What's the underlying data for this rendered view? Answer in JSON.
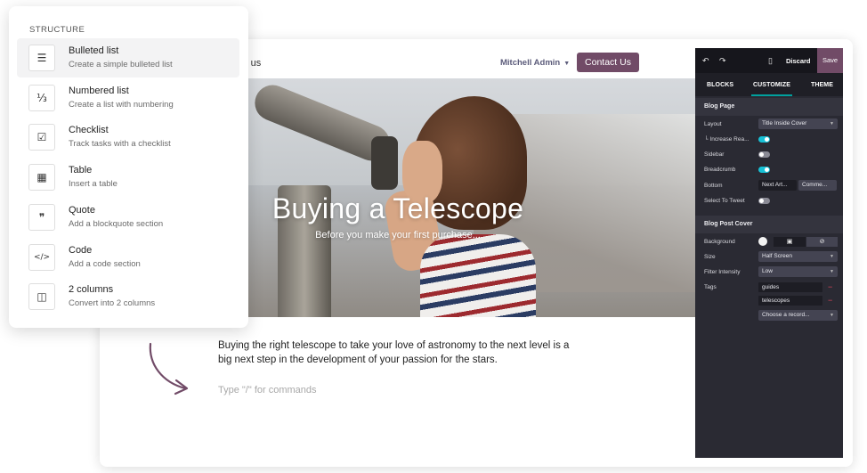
{
  "site": {
    "nav_link": "ct us",
    "user_name": "Mitchell Admin",
    "contact_button": "Contact Us"
  },
  "hero": {
    "title": "Buying a Telescope",
    "subtitle": "Before you make your first purchase..."
  },
  "article": {
    "paragraph": "Buying the right telescope to take your love of astronomy to the next level is a big next step in the development of your passion for the stars.",
    "command_placeholder": "Type \"/\" for commands"
  },
  "command_menu": {
    "header": "STRUCTURE",
    "items": [
      {
        "title": "Bulleted list",
        "desc": "Create a simple bulleted list",
        "icon": "list-ul-icon",
        "glyph": "☰"
      },
      {
        "title": "Numbered list",
        "desc": "Create a list with numbering",
        "icon": "list-ol-icon",
        "glyph": "⅓"
      },
      {
        "title": "Checklist",
        "desc": "Track tasks with a checklist",
        "icon": "check-square-icon",
        "glyph": "☑"
      },
      {
        "title": "Table",
        "desc": "Insert a table",
        "icon": "table-icon",
        "glyph": "▦"
      },
      {
        "title": "Quote",
        "desc": "Add a blockquote section",
        "icon": "quote-icon",
        "glyph": "❞"
      },
      {
        "title": "Code",
        "desc": "Add a code section",
        "icon": "code-icon",
        "glyph": "</>"
      },
      {
        "title": "2 columns",
        "desc": "Convert into 2 columns",
        "icon": "columns-icon",
        "glyph": "◫"
      }
    ]
  },
  "editor": {
    "undo_icon": "undo-icon",
    "redo_icon": "redo-icon",
    "mobile_icon": "mobile-icon",
    "discard": "Discard",
    "save": "Save",
    "tabs": [
      "BLOCKS",
      "CUSTOMIZE",
      "THEME"
    ],
    "blog_page": {
      "title": "Blog Page",
      "layout_label": "Layout",
      "layout_value": "Title Inside Cover",
      "increase_label": "└ Increase Rea...",
      "sidebar_label": "Sidebar",
      "breadcrumb_label": "Breadcrumb",
      "bottom_label": "Bottom",
      "bottom_value_1": "Next Art...",
      "bottom_value_2": "Comme...",
      "tweet_label": "Select To Tweet"
    },
    "cover": {
      "title": "Blog Post Cover",
      "background_label": "Background",
      "size_label": "Size",
      "size_value": "Half Screen",
      "filter_label": "Filter Intensity",
      "filter_value": "Low",
      "tags_label": "Tags",
      "tags": [
        "guides",
        "telescopes"
      ],
      "choose": "Choose a record..."
    },
    "accent": "#714b67",
    "toggle_color": "#17c1d6"
  }
}
